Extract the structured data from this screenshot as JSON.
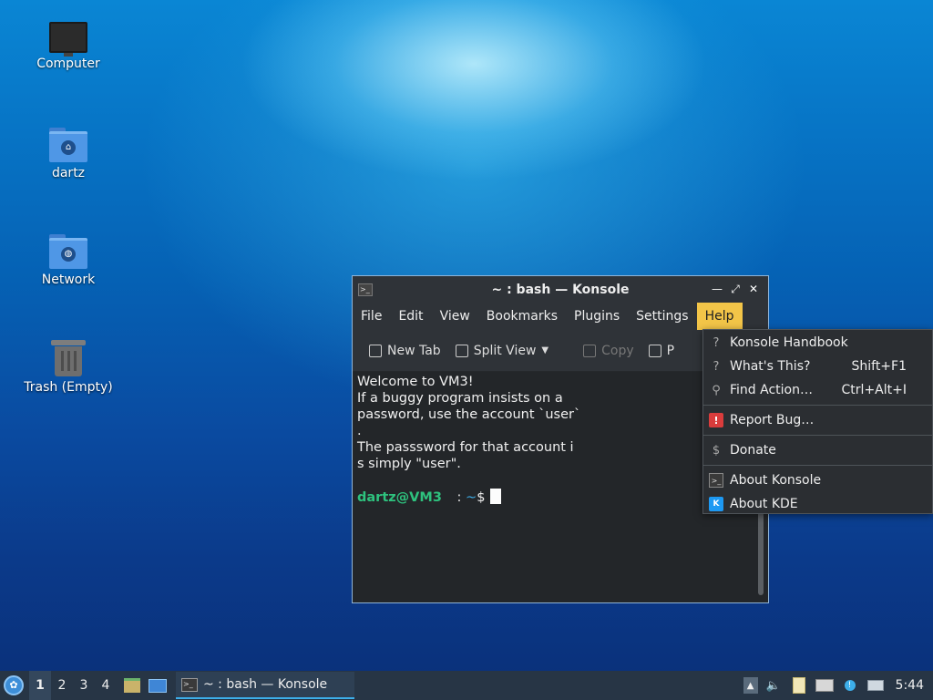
{
  "desktop": {
    "icons": [
      {
        "label": "Computer"
      },
      {
        "label": "dartz"
      },
      {
        "label": "Network"
      },
      {
        "label": "Trash (Empty)"
      }
    ]
  },
  "window": {
    "title": "~ : bash — Konsole",
    "menu": [
      "File",
      "Edit",
      "View",
      "Bookmarks",
      "Plugins",
      "Settings",
      "Help"
    ],
    "active_menu": "Help",
    "toolbar": {
      "new_tab": "New Tab",
      "split_view": "Split View",
      "copy": "Copy",
      "paste": "P"
    },
    "terminal": {
      "lines": [
        "Welcome to VM3!",
        "If a buggy program insists on a",
        "password, use the account `user`",
        ".",
        "The passsword for that account i",
        "s simply \"user\"."
      ],
      "prompt_user": "dartz@VM3",
      "prompt_sep": " : ",
      "prompt_dir": "~",
      "prompt_symbol": "$"
    }
  },
  "help_menu": {
    "items": [
      {
        "label": "Konsole Handbook",
        "shortcut": "",
        "icon": "help-icon"
      },
      {
        "label": "What's This?",
        "shortcut": "Shift+F1",
        "icon": "whats-this-icon"
      },
      {
        "label": "Find Action…",
        "shortcut": "Ctrl+Alt+I",
        "icon": "search-icon"
      },
      {
        "label": "Report Bug…",
        "shortcut": "",
        "icon": "bug-icon"
      },
      {
        "label": "Donate",
        "shortcut": "",
        "icon": "dollar-icon"
      },
      {
        "label": "About Konsole",
        "shortcut": "",
        "icon": "konsole-icon"
      },
      {
        "label": "About KDE",
        "shortcut": "",
        "icon": "kde-icon"
      }
    ]
  },
  "taskbar": {
    "workspaces": [
      "1",
      "2",
      "3",
      "4"
    ],
    "active_workspace": "1",
    "task_label": "~ : bash — Konsole",
    "clock": "5:44"
  }
}
